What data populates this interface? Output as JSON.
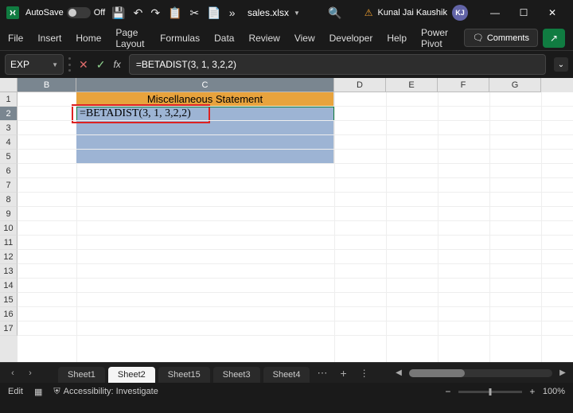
{
  "titlebar": {
    "autosave_label": "AutoSave",
    "autosave_state": "Off",
    "filename": "sales.xlsx",
    "username": "Kunal Jai Kaushik",
    "avatar_initials": "KJ"
  },
  "ribbon": {
    "tabs": [
      "File",
      "Insert",
      "Home",
      "Page Layout",
      "Formulas",
      "Data",
      "Review",
      "View",
      "Developer",
      "Help",
      "Power Pivot"
    ],
    "comments_label": "Comments"
  },
  "formula": {
    "namebox": "EXP",
    "fx_label": "fx",
    "value": "=BETADIST(3, 1, 3,2,2)"
  },
  "grid": {
    "columns": [
      "B",
      "C",
      "D",
      "E",
      "F",
      "G"
    ],
    "row_count": 17,
    "cells": {
      "C1": "Miscellaneous Statement",
      "B2": "=BETADIST(3, 1, 3,2,2)"
    },
    "selected_col_index_start": 0,
    "selected_col_index_end": 1,
    "selected_row": 2
  },
  "sheets": {
    "nav_prev": "‹",
    "nav_next": "›",
    "tabs": [
      "Sheet1",
      "Sheet2",
      "Sheet15",
      "Sheet3",
      "Sheet4"
    ],
    "active_index": 1,
    "more": "⋯",
    "add": "+",
    "menu": "⋮"
  },
  "statusbar": {
    "mode": "Edit",
    "accessibility": "Accessibility: Investigate",
    "zoom_minus": "−",
    "zoom_plus": "+",
    "zoom_value": "100%"
  },
  "icons": {
    "save": "💾",
    "undo": "↶",
    "redo": "↷",
    "touch": "🖐",
    "clipboard": "📋",
    "cut": "✂",
    "paste": "📄",
    "more": "»",
    "search": "🔍",
    "warn": "⚠",
    "minimize": "—",
    "maximize": "☐",
    "close": "✕",
    "comment": "🗨",
    "share": "↗",
    "cancel": "✕",
    "enter": "✓",
    "expand": "⌄",
    "display": "▦",
    "person": "⛨"
  }
}
